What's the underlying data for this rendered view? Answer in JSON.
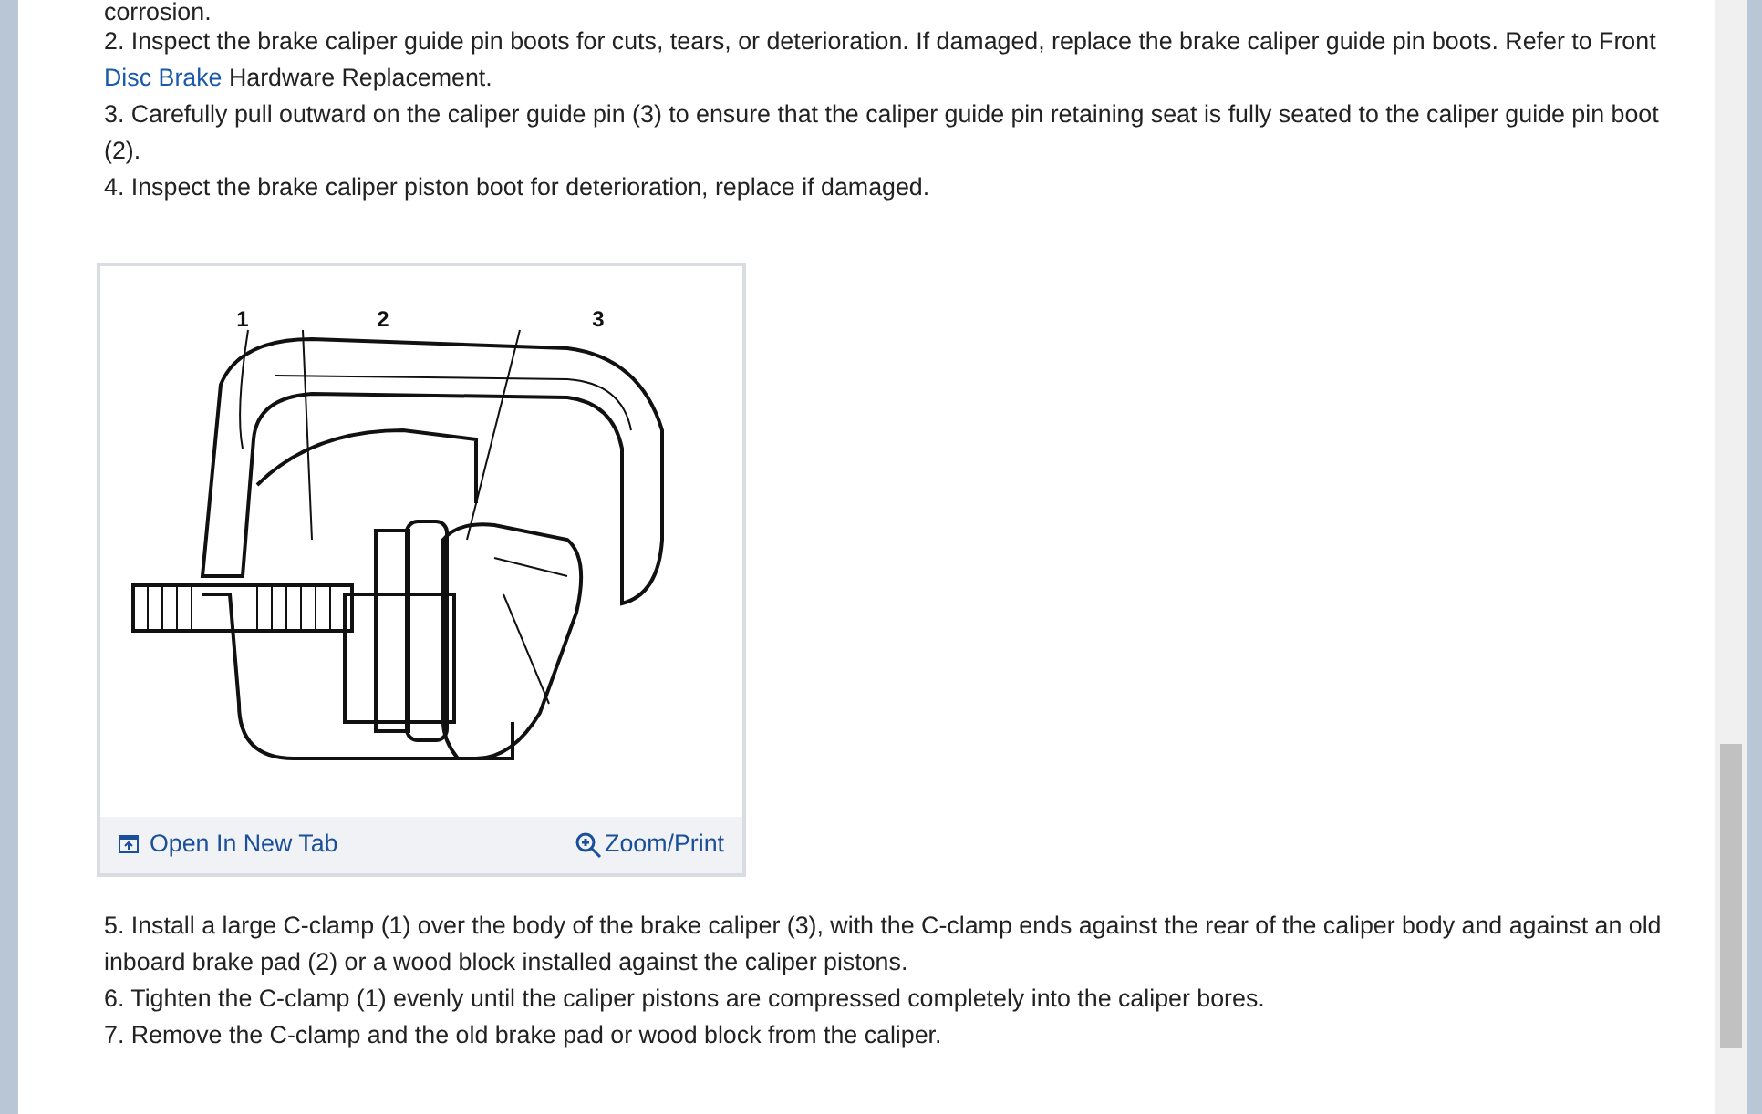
{
  "intro_fragment": "corrosion.",
  "steps_before": [
    {
      "segments": [
        {
          "kind": "plain",
          "text": "2. Inspect the brake caliper guide pin boots for cuts, tears, or deterioration. If damaged, replace the brake caliper guide pin boots. Refer to Front "
        },
        {
          "kind": "link",
          "text": "Disc Brake"
        },
        {
          "kind": "plain",
          "text": " Hardware Replacement."
        }
      ]
    },
    {
      "segments": [
        {
          "kind": "plain",
          "text": "3. Carefully pull outward on the caliper guide pin (3) to ensure that the caliper guide pin retaining seat is fully seated to the caliper guide pin boot (2)."
        }
      ]
    },
    {
      "segments": [
        {
          "kind": "plain",
          "text": "4. Inspect the brake caliper piston boot for deterioration, replace if damaged."
        }
      ]
    }
  ],
  "figure": {
    "callouts": [
      "1",
      "2",
      "3"
    ],
    "open_link": "Open In New Tab",
    "zoom_link": "Zoom/Print"
  },
  "steps_after": [
    {
      "segments": [
        {
          "kind": "plain",
          "text": "5. Install a large C-clamp (1) over the body of the brake caliper (3), with the C-clamp ends against the rear of the caliper body and against an old inboard brake pad (2) or a wood block installed against the caliper pistons."
        }
      ]
    },
    {
      "segments": [
        {
          "kind": "plain",
          "text": "6. Tighten the C-clamp (1) evenly until the caliper pistons are compressed completely into the caliper bores."
        }
      ]
    },
    {
      "segments": [
        {
          "kind": "plain",
          "text": "7. Remove the C-clamp and the old brake pad or wood block from the caliper."
        }
      ]
    }
  ]
}
